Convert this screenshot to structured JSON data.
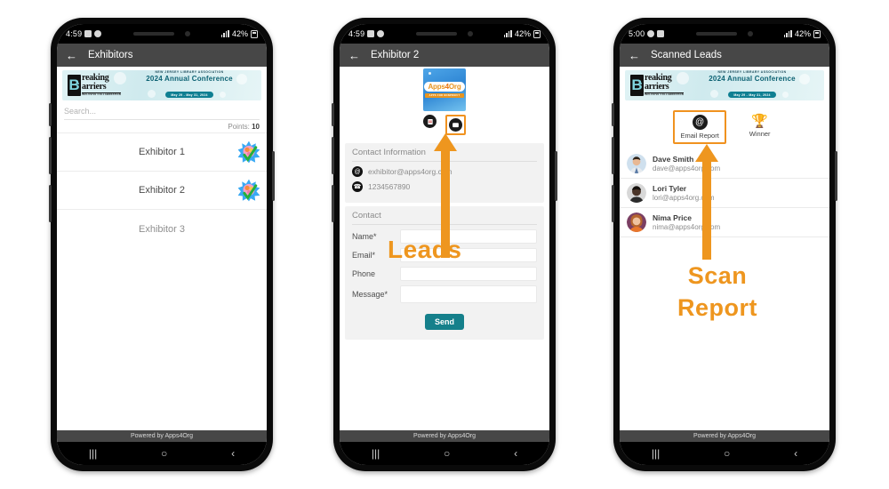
{
  "banner": {
    "logo_b": "B",
    "logo_line1": "reaking",
    "logo_line2": "arriers",
    "logo_tagline": "INCLUSIVE COLLABORATION",
    "association": "NEW JERSEY LIBRARY ASSOCIATION",
    "conference": "2024 Annual Conference",
    "dates": "May 29 - May 31, 2024"
  },
  "phone1": {
    "status": {
      "time": "4:59",
      "battery": "42%"
    },
    "appbar": {
      "title": "Exhibitors",
      "back_icon": "back-arrow-icon"
    },
    "search": {
      "placeholder": "Search...",
      "value": ""
    },
    "points_label": "Points:",
    "points_value": "10",
    "exhibitors": [
      {
        "name": "Exhibitor 1",
        "scanned": true
      },
      {
        "name": "Exhibitor 2",
        "scanned": true
      },
      {
        "name": "Exhibitor 3",
        "scanned": false
      }
    ],
    "footer": "Powered by Apps4Org",
    "nav": {
      "recents": "|||",
      "home": "○",
      "back": "‹"
    }
  },
  "phone2": {
    "status": {
      "time": "4:59",
      "battery": "42%"
    },
    "appbar": {
      "title": "Exhibitor 2",
      "back_icon": "back-arrow-icon"
    },
    "logo": {
      "text_left": "Apps",
      "text_four": "4",
      "text_right": "Org",
      "sub": "APPS FOR NONPROFIT"
    },
    "icons": [
      {
        "name": "document-icon",
        "highlighted": false
      },
      {
        "name": "contact-card-icon",
        "highlighted": true
      }
    ],
    "contact_information": {
      "title": "Contact Information",
      "email": "exhibitor@apps4org.com",
      "phone": "1234567890"
    },
    "contact_form": {
      "title": "Contact",
      "fields": [
        {
          "label": "Name*",
          "value": ""
        },
        {
          "label": "Email*",
          "value": ""
        },
        {
          "label": "Phone",
          "value": ""
        },
        {
          "label": "Message*",
          "value": ""
        }
      ],
      "submit_label": "Send"
    },
    "footer": "Powered by Apps4Org",
    "nav": {
      "recents": "|||",
      "home": "○",
      "back": "‹"
    }
  },
  "phone3": {
    "status": {
      "time": "5:00",
      "battery": "42%"
    },
    "appbar": {
      "title": "Scanned Leads",
      "back_icon": "back-arrow-icon"
    },
    "actions": [
      {
        "label": "Email Report",
        "icon": "email-at-icon",
        "highlighted": true
      },
      {
        "label": "Winner",
        "icon": "trophy-icon",
        "highlighted": false
      }
    ],
    "leads": [
      {
        "name": "Dave Smith",
        "email": "dave@apps4org.com"
      },
      {
        "name": "Lori Tyler",
        "email": "lori@apps4org.com"
      },
      {
        "name": "Nima Price",
        "email": "nima@apps4org.com"
      }
    ],
    "footer": "Powered by Apps4Org",
    "nav": {
      "recents": "|||",
      "home": "○",
      "back": "‹"
    }
  },
  "annotations": {
    "leads": "Leads",
    "scan_line1": "Scan",
    "scan_line2": "Report",
    "color": "#ee961f"
  }
}
